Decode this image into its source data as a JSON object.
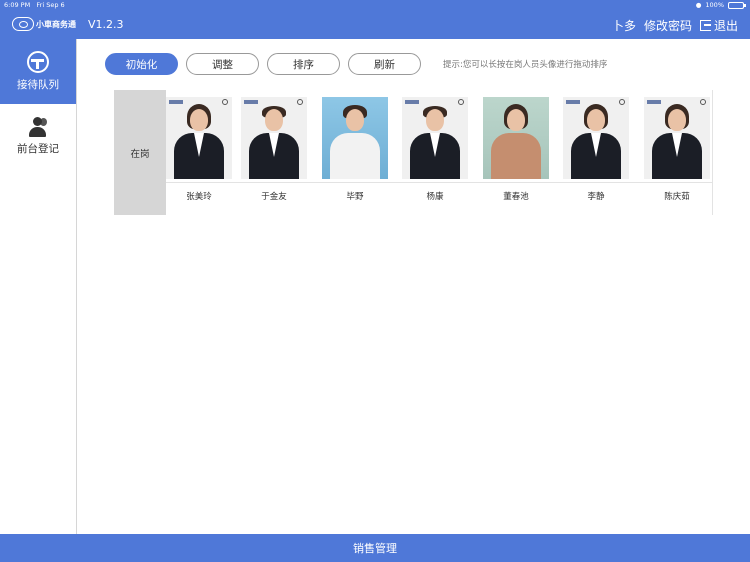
{
  "status_bar": {
    "time": "6:09 PM",
    "date": "Fri Sep 6",
    "battery": "100%"
  },
  "header": {
    "logo_text": "小車商务通",
    "version": "V1.2.3",
    "user_name": "卜多",
    "change_password": "修改密码",
    "logout": "退出"
  },
  "sidebar": {
    "items": [
      {
        "label": "接待队列",
        "icon": "steering-wheel-icon",
        "active": true
      },
      {
        "label": "前台登记",
        "icon": "users-icon",
        "active": false
      }
    ]
  },
  "toolbar": {
    "init_label": "初始化",
    "adjust_label": "调整",
    "sort_label": "排序",
    "refresh_label": "刷新",
    "hint": "提示:您可以长按在岗人员头像进行拖动排序"
  },
  "queue": {
    "section_label": "在岗",
    "staff": [
      {
        "name": "张美玲"
      },
      {
        "name": "于金友"
      },
      {
        "name": "毕野"
      },
      {
        "name": "杨康"
      },
      {
        "name": "董春池"
      },
      {
        "name": "李静"
      },
      {
        "name": "陈庆茹"
      }
    ]
  },
  "footer": {
    "label": "销售管理"
  },
  "colors": {
    "accent": "#4f78d8",
    "label_bg": "#d6d6d6"
  }
}
